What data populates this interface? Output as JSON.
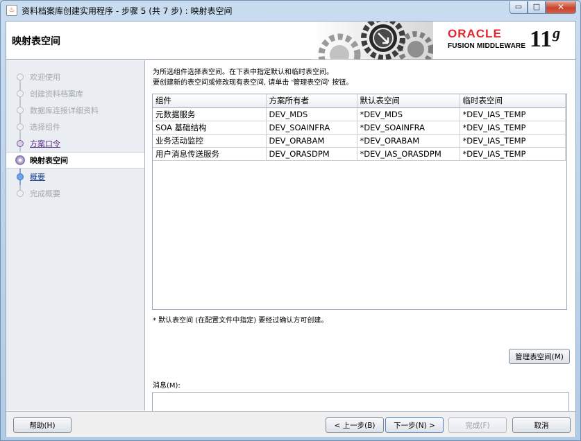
{
  "window": {
    "title": "资料档案库创建实用程序 - 步骤 5 (共 7 步) : 映射表空间",
    "app_icon": "java-cup-icon",
    "minimize_symbol": "▭",
    "maximize_symbol": "□",
    "close_symbol": "✕"
  },
  "header": {
    "page_title": "映射表空间",
    "oracle_text": "ORACLE",
    "fusion_text": "FUSION MIDDLEWARE",
    "version_number": "11",
    "version_letter": "g"
  },
  "steps": [
    {
      "label": "欢迎使用",
      "state": "disabled"
    },
    {
      "label": "创建资料档案库",
      "state": "disabled"
    },
    {
      "label": "数据库连接详细资料",
      "state": "disabled"
    },
    {
      "label": "选择组件",
      "state": "disabled"
    },
    {
      "label": "方案口令",
      "state": "link"
    },
    {
      "label": "映射表空间",
      "state": "current"
    },
    {
      "label": "概要",
      "state": "next"
    },
    {
      "label": "完成概要",
      "state": "disabled"
    }
  ],
  "main": {
    "intro_line1": "为所选组件选择表空间。在下表中指定默认和临时表空间。",
    "intro_line2": "要创建新的表空间或修改现有表空间, 请单击 '管理表空间' 按钮。",
    "table": {
      "headers": [
        "组件",
        "方案所有者",
        "默认表空间",
        "临时表空间"
      ],
      "rows": [
        [
          "元数据服务",
          "DEV_MDS",
          "*DEV_MDS",
          "*DEV_IAS_TEMP"
        ],
        [
          "SOA 基础结构",
          "DEV_SOAINFRA",
          "*DEV_SOAINFRA",
          "*DEV_IAS_TEMP"
        ],
        [
          "业务活动监控",
          "DEV_ORABAM",
          "*DEV_ORABAM",
          "*DEV_IAS_TEMP"
        ],
        [
          "用户消息传送服务",
          "DEV_ORASDPM",
          "*DEV_IAS_ORASDPM",
          "*DEV_IAS_TEMP"
        ]
      ]
    },
    "footnote": "* 默认表空间 (在配置文件中指定) 要经过确认方可创建。",
    "manage_button": "管理表空间(M)",
    "messages_label": "消息(M):",
    "messages_value": ""
  },
  "footer": {
    "help": "帮助(H)",
    "back": "< 上一步(B)",
    "next": "下一步(N) >",
    "finish": "完成(F)",
    "cancel": "取消"
  }
}
